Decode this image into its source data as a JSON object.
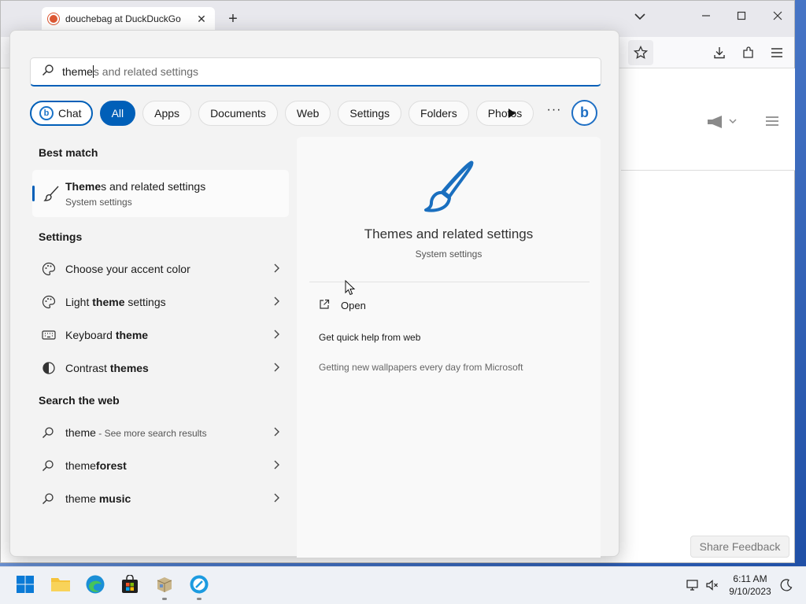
{
  "browser": {
    "tab_title": "douchebag at DuckDuckGo",
    "tab_close": "✕",
    "new_tab": "+",
    "share_feedback": "Share Feedback"
  },
  "search": {
    "typed": "theme",
    "completion": "s and related settings"
  },
  "filters": [
    {
      "label": "Chat"
    },
    {
      "label": "All",
      "active": true
    },
    {
      "label": "Apps"
    },
    {
      "label": "Documents"
    },
    {
      "label": "Web"
    },
    {
      "label": "Settings"
    },
    {
      "label": "Folders"
    },
    {
      "label": "Photos"
    }
  ],
  "more_label": "···",
  "sections": {
    "best_match": "Best match",
    "settings": "Settings",
    "search_web": "Search the web"
  },
  "best_match": {
    "title_bold": "Theme",
    "title_rest": "s and related settings",
    "subtitle": "System settings"
  },
  "settings_results": [
    {
      "pre": "Choose your accent color",
      "bold": "",
      "post": "",
      "icon": "palette-icon"
    },
    {
      "pre": "Light ",
      "bold": "theme",
      "post": " settings",
      "icon": "palette-icon"
    },
    {
      "pre": "Keyboard ",
      "bold": "theme",
      "post": "",
      "icon": "keyboard-icon"
    },
    {
      "pre": "Contrast ",
      "bold": "themes",
      "post": "",
      "icon": "contrast-icon"
    }
  ],
  "web_results": [
    {
      "main": "theme",
      "hint": " - See more search results"
    },
    {
      "pre": "theme",
      "bold": "forest"
    },
    {
      "pre": "theme ",
      "bold": "music"
    }
  ],
  "preview": {
    "title": "Themes and related settings",
    "subtitle": "System settings",
    "open": "Open",
    "quick_help": "Get quick help from web",
    "wallpapers": "Getting new wallpapers every day from Microsoft"
  },
  "clock": {
    "time": "6:11 AM",
    "date": "9/10/2023"
  },
  "colors": {
    "accent": "#005fb8",
    "brush_icon": "#1a6fbf"
  }
}
